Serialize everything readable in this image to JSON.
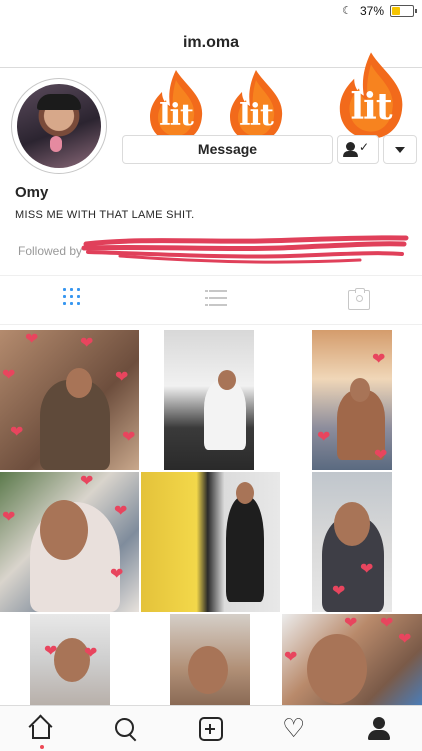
{
  "status_bar": {
    "battery_percent": "37%"
  },
  "header": {
    "username": "im.oma"
  },
  "profile": {
    "name": "Omy",
    "bio": "MISS ME WITH THAT LAME SHIT.",
    "followed_by": "Followed by",
    "message_button": "Message",
    "stickers": [
      "lit",
      "lit",
      "lit"
    ]
  },
  "tabs": [
    "grid-view",
    "list-view",
    "tagged-view"
  ],
  "bottom_nav": [
    "home",
    "search",
    "add-post",
    "activity",
    "profile"
  ],
  "colors": {
    "accent_blue": "#3897f0",
    "heart_red": "#e8455e",
    "scribble_red": "#e0405a",
    "flame_orange": "#f26a1b"
  }
}
